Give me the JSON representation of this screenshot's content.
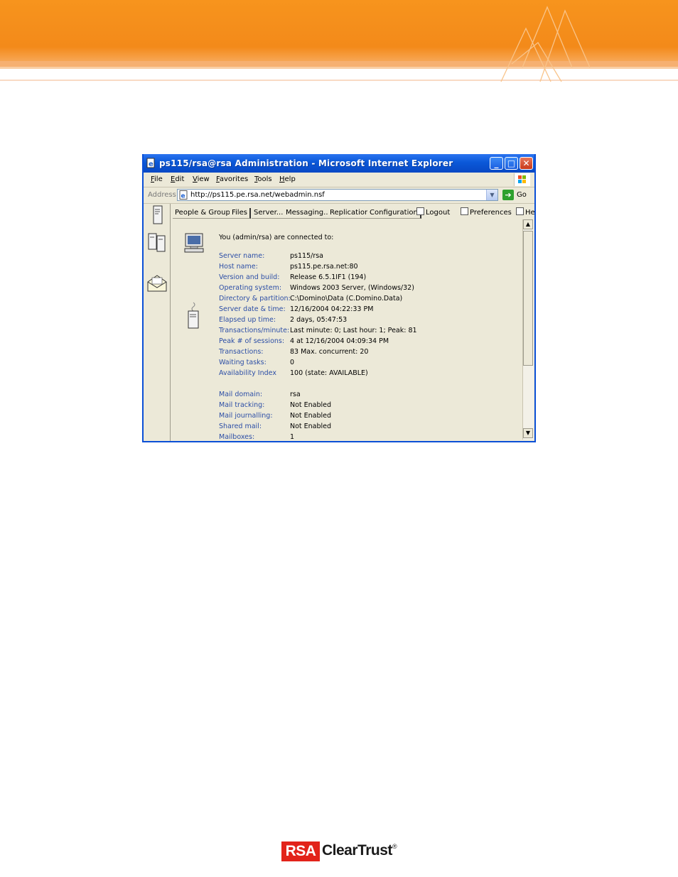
{
  "window": {
    "title": "ps115/rsa@rsa Administration - Microsoft Internet Explorer",
    "controls": {
      "minimize": "_",
      "maximize": "□",
      "close": "✕"
    }
  },
  "menu": [
    "File",
    "Edit",
    "View",
    "Favorites",
    "Tools",
    "Help"
  ],
  "address": {
    "label": "Address",
    "url": "http://ps115.pe.rsa.net/webadmin.nsf",
    "go_label": "Go"
  },
  "tabs": [
    "People & Groups",
    "Files",
    "Server...",
    "Messaging...",
    "Replication",
    "Configuration"
  ],
  "checkboxes": [
    "Logout",
    "Preferences",
    "He"
  ],
  "connected_text": "You (admin/rsa) are connected to:",
  "server_info": [
    {
      "label": "Server name:",
      "value": "ps115/rsa"
    },
    {
      "label": "Host name:",
      "value": "ps115.pe.rsa.net:80"
    },
    {
      "label": "Version and build:",
      "value": "Release 6.5.1IF1 (194)"
    },
    {
      "label": "Operating system:",
      "value": "Windows 2003 Server, (Windows/32)"
    },
    {
      "label": "Directory & partition:",
      "value": "C:\\Domino\\Data (C.Domino.Data)"
    },
    {
      "label": "Server date & time:",
      "value": "12/16/2004 04:22:33 PM"
    },
    {
      "label": "Elapsed up time:",
      "value": "2 days, 05:47:53"
    },
    {
      "label": "Transactions/minute:",
      "value": "Last minute: 0; Last hour: 1; Peak: 81"
    },
    {
      "label": "Peak # of sessions:",
      "value": "4 at 12/16/2004 04:09:34 PM"
    },
    {
      "label": "Transactions:",
      "value": "83  Max. concurrent: 20"
    },
    {
      "label": "Waiting tasks:",
      "value": "0"
    },
    {
      "label": "Availability Index",
      "value": "100 (state: AVAILABLE)"
    }
  ],
  "mail_info": [
    {
      "label": "Mail domain:",
      "value": "rsa"
    },
    {
      "label": "Mail tracking:",
      "value": "Not Enabled"
    },
    {
      "label": "Mail journalling:",
      "value": "Not Enabled"
    },
    {
      "label": "Shared mail:",
      "value": "Not Enabled"
    },
    {
      "label": "Mailboxes:",
      "value": "1"
    }
  ],
  "logo": {
    "brand": "RSA",
    "product": "ClearTrust",
    "mark": "®"
  },
  "colors": {
    "banner": "#f7941d",
    "titlebar": "#0a58d8",
    "label_blue": "#2c4ea6",
    "rsa_red": "#e2231a"
  }
}
